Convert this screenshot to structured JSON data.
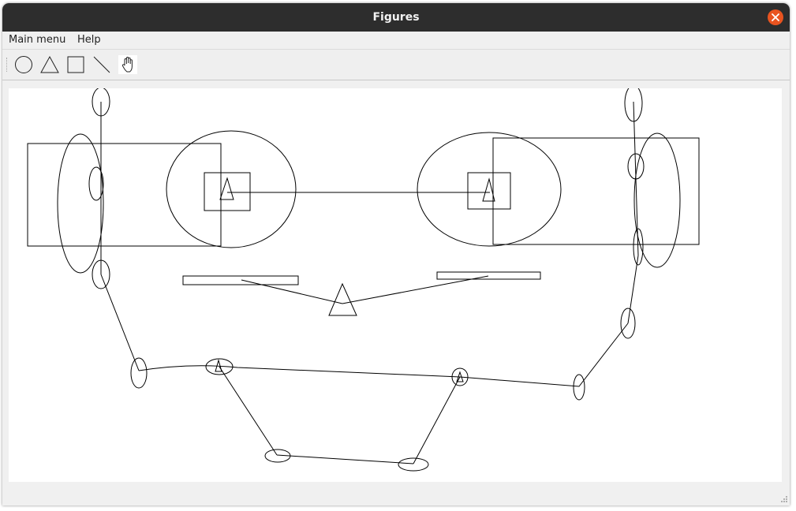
{
  "window": {
    "title": "Figures"
  },
  "menu": {
    "items": [
      "Main menu",
      "Help"
    ]
  },
  "toolbar": {
    "tools": [
      "circle-tool",
      "triangle-tool",
      "rectangle-tool",
      "line-tool",
      "hand-tool"
    ]
  },
  "colors": {
    "titlebar": "#2d2d2d",
    "close_button": "#e95420",
    "window_bg": "#f0f0f0",
    "canvas_bg": "#ffffff",
    "stroke": "#000000"
  }
}
